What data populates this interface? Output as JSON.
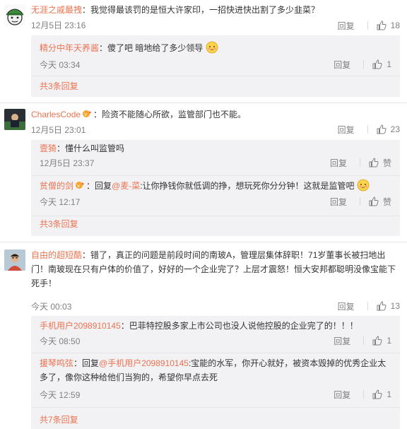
{
  "comments": [
    {
      "user": "无涯之戚最拽",
      "text": "：我觉得最该罚的是恒大许家印，一招快进快出割了多少韭菜？",
      "time": "12月5日 23:16",
      "reply_label": "回复",
      "likes": "18",
      "subs": [
        {
          "user": "精分中年天养酱",
          "text": "：傻了吧 暗地给了多少领导",
          "time": "今天 03:34",
          "reply_label": "回复",
          "likes": "1"
        }
      ],
      "more": "共3条回复"
    },
    {
      "user": "CharlesCode",
      "text": "：险资不能随心所欲，监管部门也不能。",
      "time": "12月5日 23:01",
      "reply_label": "回复",
      "likes": "23",
      "subs": [
        {
          "user": "壹猗",
          "text": "：懂什么叫监管吗",
          "time": "12月5日 23:37",
          "reply_label": "回复",
          "likes": "赞"
        },
        {
          "user": "贫僧的剑",
          "text_pre": "：回复",
          "at": "@麦-菜",
          "text": ":让你挣钱你就低调的挣，想玩死你分分钟！这就是监管吧",
          "time": "今天 12:17",
          "reply_label": "回复",
          "likes": "赞"
        }
      ],
      "more": "共3条回复"
    },
    {
      "user": "自由的超短酷",
      "text_line1": "：错了，真正的问题是前段时间的南玻A，管理层集体辞职！71岁董事长被扫地出",
      "text_line2": "门！南玻现在只有户体的价值了，好好的一个企业完了？上层才震怒！恒大安邦都聪明没像宝能下",
      "text_line3": "死手！",
      "time": "今天 00:03",
      "reply_label": "回复",
      "likes": "13",
      "subs": [
        {
          "user": "手机用户2098910145",
          "text": "：巴菲特控股多家上市公司也没人说他控股的企业完了的！！！",
          "time": "今天 08:50",
          "reply_label": "回复",
          "likes": "1"
        },
        {
          "user": "援琴鸣弦",
          "text_pre": "：回复",
          "at": "@手机用户2098910145",
          "text": ":宝能的水军，你开心就好，被资本毁掉的优秀企业太",
          "text_line2": "多了，像你这种给他们当狗的，希望你早点去死",
          "time": "今天 12:59",
          "reply_label": "回复",
          "likes": "1"
        }
      ],
      "more": "共7条回复"
    }
  ],
  "colors": {
    "accent": "#eb7350",
    "gray": "#808080",
    "subbg": "#f2f2f5"
  }
}
